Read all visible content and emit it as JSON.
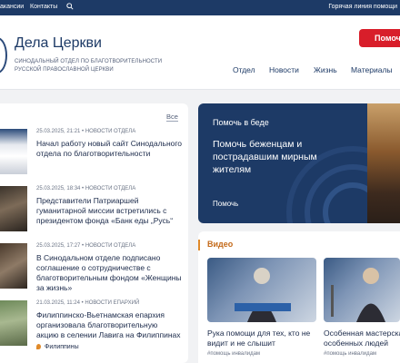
{
  "topbar": {
    "vacancies": "акансии",
    "contacts": "Контакты",
    "hotline": "Горячая линия помощи"
  },
  "header": {
    "title": "Дела Церкви",
    "subtitle": "Синодальный отдел по благотворительности Русской Православной Церкви",
    "help_button": "Помоч",
    "nav": [
      "Отдел",
      "Новости",
      "Жизнь",
      "Материалы"
    ]
  },
  "news": {
    "all_label": "Все",
    "items": [
      {
        "meta": "25.03.2025, 21:21 • НОВОСТИ ОТДЕЛА",
        "title": "Начал работу новый сайт Синодального отдела по благотворительности",
        "tag": ""
      },
      {
        "meta": "25.03.2025, 18:34 • НОВОСТИ ОТДЕЛА",
        "title": "Представители Патриаршей гуманитарной миссии встретились с президентом фонда «Банк еды „Русь“",
        "tag": ""
      },
      {
        "meta": "25.03.2025, 17:27 • НОВОСТИ ОТДЕЛА",
        "title": "В Синодальном отделе подписано соглашение о сотрудничестве с благотворительным фондом «Женщины за жизнь»",
        "tag": ""
      },
      {
        "meta": "21.03.2025, 11:24 • НОВОСТИ ЕПАРХИЙ",
        "title": "Филиппинско-Вьетнамская епархия организовала благотворительную акцию в селении Лавига на Филиппинах",
        "tag": "Филиппины"
      }
    ]
  },
  "banner": {
    "label": "Помочь в беде",
    "title": "Помочь беженцам и пострадавшим мирным жителям",
    "action": "Помочь"
  },
  "video": {
    "title": "Видео",
    "cards": [
      {
        "title": "Рука помощи для тех, кто не видит и не слышит",
        "tag": "#помощь инвалидам"
      },
      {
        "title": "Особенная мастерская особенных людей",
        "tag": "#помощь инвалидам"
      }
    ]
  },
  "colors": {
    "navy": "#1d3a66",
    "accent_red": "#d81e2a",
    "accent_orange": "#e08a2a"
  }
}
